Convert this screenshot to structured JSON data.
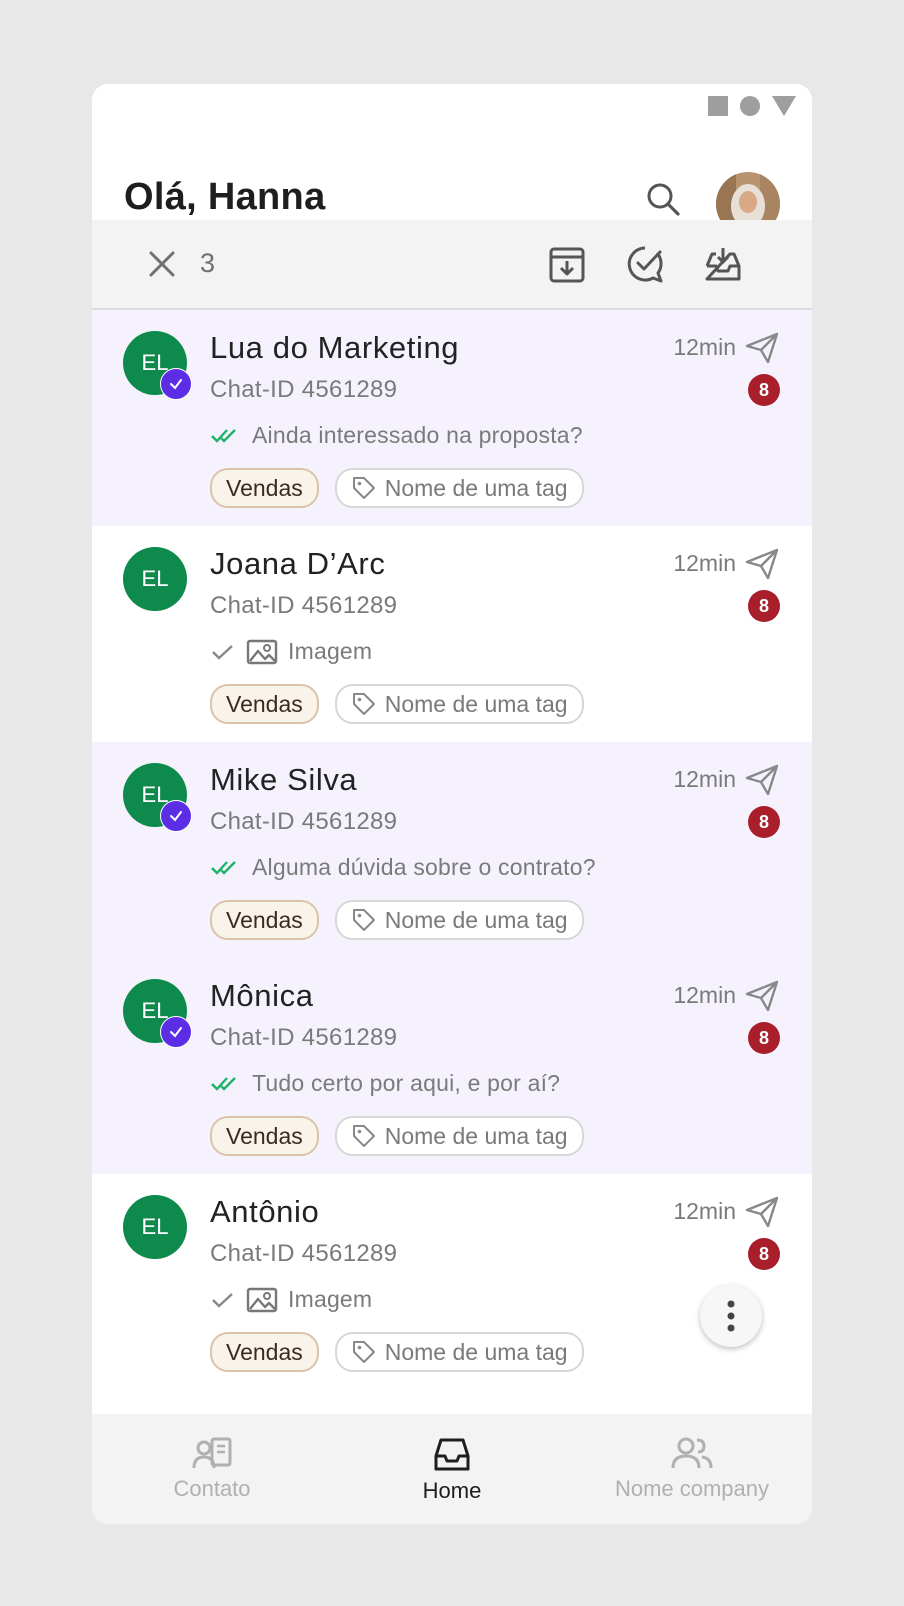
{
  "header": {
    "greeting": "Olá, Hanna"
  },
  "selection": {
    "count": "3"
  },
  "conversations": [
    {
      "name": "Lua do Marketing",
      "chat_id": "Chat-ID 4561289",
      "time": "12min",
      "unread": "8",
      "preview": "Ainda interessado na proposta?",
      "tag_primary": "Vendas",
      "tag_secondary": "Nome de uma tag"
    },
    {
      "name": "Joana D’Arc",
      "chat_id": "Chat-ID 4561289",
      "time": "12min",
      "unread": "8",
      "preview": "Imagem",
      "tag_primary": "Vendas",
      "tag_secondary": "Nome de uma tag"
    },
    {
      "name": "Mike Silva",
      "chat_id": "Chat-ID 4561289",
      "time": "12min",
      "unread": "8",
      "preview": "Alguma dúvida sobre o contrato?",
      "tag_primary": "Vendas",
      "tag_secondary": "Nome de uma tag"
    },
    {
      "name": "Mônica",
      "chat_id": "Chat-ID 4561289",
      "time": "12min",
      "unread": "8",
      "preview": "Tudo certo por aqui, e por aí?",
      "tag_primary": "Vendas",
      "tag_secondary": "Nome de uma tag"
    },
    {
      "name": "Antônio",
      "chat_id": "Chat-ID 4561289",
      "time": "12min",
      "unread": "8",
      "preview": "Imagem",
      "tag_primary": "Vendas",
      "tag_secondary": "Nome de uma tag"
    }
  ],
  "avatar_initials": "EL",
  "nav": {
    "contact": "Contato",
    "home": "Home",
    "company": "Nome company"
  },
  "colors": {
    "avatar_bg": "#0e8a4c",
    "selected_bg": "#f6f2fd",
    "check_badge": "#5b2ee6",
    "unread_badge": "#a81e2a",
    "read_ticks": "#1db36a"
  }
}
